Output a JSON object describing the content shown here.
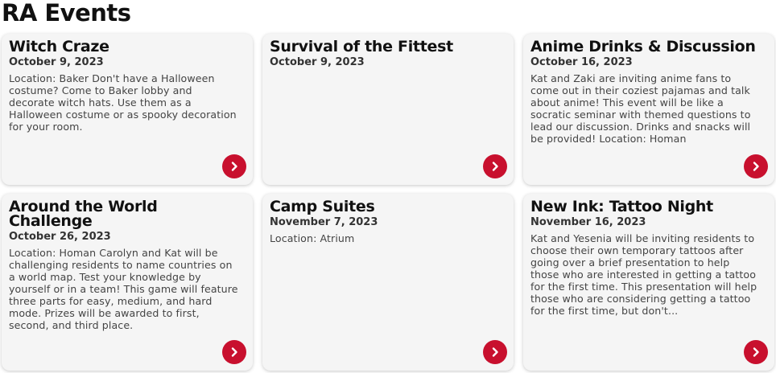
{
  "page": {
    "title": "RA Events"
  },
  "colors": {
    "accent": "#c8102e",
    "card_bg": "#f5f5f5"
  },
  "events": [
    {
      "title": "Witch Craze",
      "date": "October 9, 2023",
      "description": "Location: Baker Don't have a Halloween costume? Come to Baker lobby and decorate witch hats. Use them as a Halloween costume or as spooky decoration for your room.",
      "icon": "chevron-right-icon"
    },
    {
      "title": "Survival of the Fittest",
      "date": "October 9, 2023",
      "description": "",
      "icon": "chevron-right-icon"
    },
    {
      "title": "Anime Drinks & Discussion",
      "date": "October 16, 2023",
      "description": "Kat and Zaki are inviting anime fans to come out in their coziest pajamas and talk about anime! This event will be like a socratic seminar with themed questions to lead our discussion. Drinks and snacks will be provided! Location: Homan",
      "icon": "chevron-right-icon"
    },
    {
      "title": "Around the World Challenge",
      "date": "October 26, 2023",
      "description": "Location: Homan Carolyn and Kat will be challenging residents to name countries on a world map. Test your knowledge by yourself or in a team! This game will feature three parts for easy, medium, and hard mode. Prizes will be awarded to first, second, and third place.",
      "icon": "chevron-right-icon"
    },
    {
      "title": "Camp Suites",
      "date": "November 7, 2023",
      "description": "Location: Atrium",
      "icon": "chevron-right-icon"
    },
    {
      "title": "New Ink: Tattoo Night",
      "date": "November 16, 2023",
      "description": "Kat and Yesenia will be inviting residents to choose their own temporary tattoos after going over a brief presentation to help those who are interested in getting a tattoo for the first time. This presentation will help those who are considering getting a tattoo for the first time, but don't...",
      "icon": "chevron-right-icon"
    }
  ]
}
